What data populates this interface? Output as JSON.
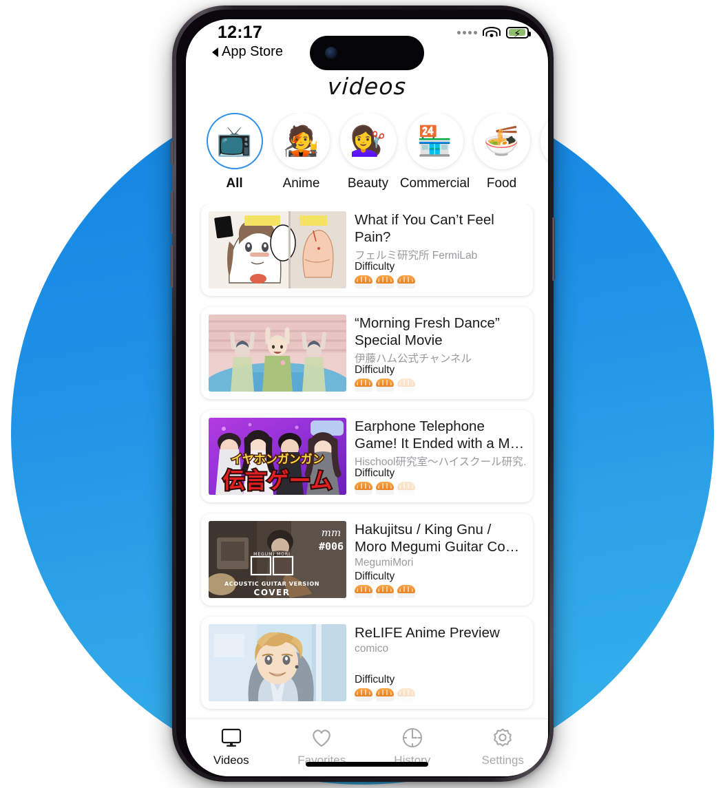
{
  "status_bar": {
    "time": "12:17",
    "back_label": "App Store",
    "back_icon": "triangle-left-icon",
    "signal_icon": "signal-dots-icon",
    "wifi_icon": "wifi-icon",
    "battery_icon": "battery-charging-icon"
  },
  "header": {
    "title": "videos"
  },
  "categories": [
    {
      "label": "All",
      "emoji": "📺",
      "icon_name": "television-icon",
      "active": true
    },
    {
      "label": "Anime",
      "emoji": "🧑‍🎤",
      "icon_name": "anime-character-icon",
      "active": false
    },
    {
      "label": "Beauty",
      "emoji": "💇‍♀️",
      "icon_name": "beauty-person-icon",
      "active": false
    },
    {
      "label": "Commercial",
      "emoji": "🏪",
      "icon_name": "storefront-icon",
      "active": false
    },
    {
      "label": "Food",
      "emoji": "🍜",
      "icon_name": "ramen-bowl-icon",
      "active": false
    },
    {
      "label": "",
      "emoji": "",
      "icon_name": "partial-category-icon",
      "active": false
    }
  ],
  "difficulty_label": "Difficulty",
  "videos": [
    {
      "title": "What if You Can’t Feel Pain?",
      "channel": "フェルミ研究所 FermiLab",
      "difficulty_filled": 3,
      "difficulty_total": 3,
      "thumb_name": "manga-panel-thumbnail"
    },
    {
      "title": "“Morning Fresh Dance” Special Movie",
      "channel": "伊藤ハム公式チャンネル",
      "difficulty_filled": 2,
      "difficulty_total": 3,
      "thumb_name": "dancers-thumbnail"
    },
    {
      "title": "Earphone Telephone Game! It Ended with a M…",
      "channel": "Hischool研究室〜ハイスクール研究…",
      "difficulty_filled": 2,
      "difficulty_total": 3,
      "thumb_name": "earphone-game-thumbnail",
      "thumb_text_top": "イヤホンガンガン",
      "thumb_text_bottom": "伝言ゲーム"
    },
    {
      "title": "Hakujitsu / King Gnu / Moro Megumi Guitar Co…",
      "channel": "MegumiMori",
      "difficulty_filled": 3,
      "difficulty_total": 3,
      "thumb_name": "guitar-cover-thumbnail",
      "thumb_text_logo": "mm",
      "thumb_text_number": "#006",
      "thumb_text_name": "MEGUMI MORI",
      "thumb_text_kanji": "白日",
      "thumb_text_version": "ACOUSTIC GUITAR VERSION",
      "thumb_text_cover": "COVER"
    },
    {
      "title": "ReLIFE Anime Preview",
      "channel": "comico",
      "difficulty_filled": 2,
      "difficulty_total": 3,
      "thumb_name": "relife-anime-thumbnail"
    }
  ],
  "tabs": [
    {
      "label": "Videos",
      "icon_name": "monitor-icon",
      "active": true
    },
    {
      "label": "Favorites",
      "icon_name": "heart-icon",
      "active": false
    },
    {
      "label": "History",
      "icon_name": "clock-icon",
      "active": false
    },
    {
      "label": "Settings",
      "icon_name": "gear-icon",
      "active": false
    }
  ],
  "colors": {
    "accent_blue": "#2d8fe8",
    "background_circle_top": "#1484e0",
    "background_circle_bottom": "#36b4ec",
    "sushi_orange": "#ef8f2e",
    "muted_text": "#9a9a9e"
  }
}
